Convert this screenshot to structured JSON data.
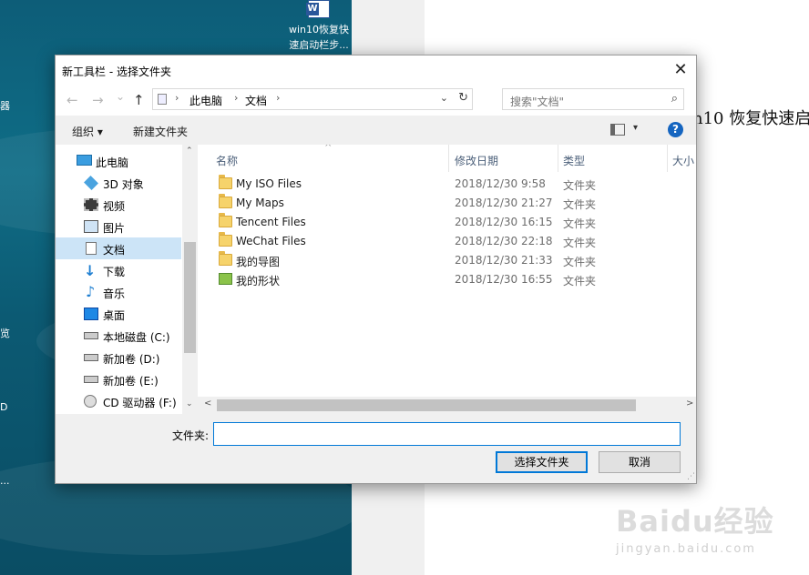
{
  "background": {
    "desktop_icon": {
      "label": "win10恢复快速启动栏步..."
    },
    "edge_texts": [
      "器",
      "览",
      "D",
      "..."
    ],
    "doc_heading": "n10 恢复快速启",
    "watermark": {
      "main": "Baidu经验",
      "sub": "jingyan.baidu.com"
    }
  },
  "dialog": {
    "title": "新工具栏 - 选择文件夹",
    "close_symbol": "✕",
    "nav": {
      "back_symbol": "←",
      "forward_symbol": "→",
      "dropdown_symbol": "⌄",
      "up_symbol": "↑",
      "breadcrumb": [
        "此电脑",
        "文档"
      ],
      "crumb_sep": "›",
      "address_dropdown_symbol": "⌄",
      "refresh_symbol": "↻",
      "search_placeholder": "搜索\"文档\"",
      "search_symbol": "⌕"
    },
    "commands": {
      "organize": "组织 ▾",
      "new_folder": "新建文件夹",
      "view_dropdown": "▾",
      "help": "?"
    },
    "nav_pane": {
      "items": [
        {
          "label": "此电脑",
          "icon": "pc-icon",
          "selected": false
        },
        {
          "label": "3D 对象",
          "icon": "cube-icon",
          "selected": false
        },
        {
          "label": "视频",
          "icon": "video-icon",
          "selected": false
        },
        {
          "label": "图片",
          "icon": "picture-icon",
          "selected": false
        },
        {
          "label": "文档",
          "icon": "document-icon",
          "selected": true
        },
        {
          "label": "下载",
          "icon": "download-icon",
          "selected": false
        },
        {
          "label": "音乐",
          "icon": "music-icon",
          "selected": false
        },
        {
          "label": "桌面",
          "icon": "desktop-icon",
          "selected": false
        },
        {
          "label": "本地磁盘 (C:)",
          "icon": "drive-icon",
          "selected": false
        },
        {
          "label": "新加卷 (D:)",
          "icon": "drive-icon",
          "selected": false
        },
        {
          "label": "新加卷 (E:)",
          "icon": "drive-icon",
          "selected": false
        },
        {
          "label": "CD 驱动器 (F:)",
          "icon": "cd-drive-icon",
          "selected": false
        }
      ],
      "scroll_up": "⌃",
      "scroll_down": "⌄"
    },
    "file_list": {
      "columns": [
        "名称",
        "修改日期",
        "类型",
        "大小"
      ],
      "sort_indicator": "^",
      "rows": [
        {
          "name": "My ISO Files",
          "date": "2018/12/30 9:58",
          "type": "文件夹",
          "icon": "folder-icon"
        },
        {
          "name": "My Maps",
          "date": "2018/12/30 21:27",
          "type": "文件夹",
          "icon": "folder-icon"
        },
        {
          "name": "Tencent Files",
          "date": "2018/12/30 16:15",
          "type": "文件夹",
          "icon": "folder-icon"
        },
        {
          "name": "WeChat Files",
          "date": "2018/12/30 22:18",
          "type": "文件夹",
          "icon": "folder-icon"
        },
        {
          "name": "我的导图",
          "date": "2018/12/30 21:33",
          "type": "文件夹",
          "icon": "folder-icon"
        },
        {
          "name": "我的形状",
          "date": "2018/12/30 16:55",
          "type": "文件夹",
          "icon": "shapes-folder-icon"
        }
      ],
      "hscroll_left": "<",
      "hscroll_right": ">"
    },
    "folder_field": {
      "label": "文件夹:",
      "value": ""
    },
    "buttons": {
      "select": "选择文件夹",
      "cancel": "取消"
    }
  }
}
